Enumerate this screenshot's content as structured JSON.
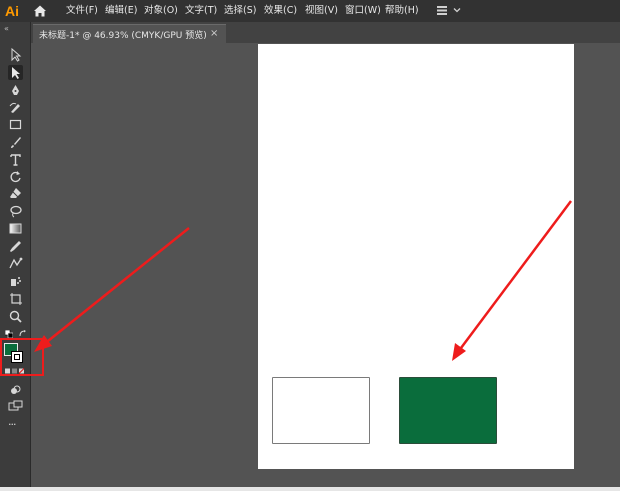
{
  "app": {
    "logo": "Ai"
  },
  "menu": [
    {
      "label": "文件(F)"
    },
    {
      "label": "编辑(E)"
    },
    {
      "label": "对象(O)"
    },
    {
      "label": "文字(T)"
    },
    {
      "label": "选择(S)"
    },
    {
      "label": "效果(C)"
    },
    {
      "label": "视图(V)"
    },
    {
      "label": "窗口(W)"
    },
    {
      "label": "帮助(H)"
    }
  ],
  "document_tab": {
    "title": "未标题-1* @ 46.93% (CMYK/GPU 预览)",
    "close": "×"
  },
  "toolbar": {
    "collapse": "«",
    "tools": [
      {
        "name": "selection-tool"
      },
      {
        "name": "direct-selection-tool"
      },
      {
        "name": "pen-tool"
      },
      {
        "name": "curvature-tool"
      },
      {
        "name": "rectangle-tool"
      },
      {
        "name": "paintbrush-tool"
      },
      {
        "name": "type-tool"
      },
      {
        "name": "rotate-tool"
      },
      {
        "name": "eraser-tool"
      },
      {
        "name": "lasso-tool"
      },
      {
        "name": "gradient-tool"
      },
      {
        "name": "eyedropper-tool"
      },
      {
        "name": "blend-tool"
      },
      {
        "name": "symbol-sprayer-tool"
      },
      {
        "name": "artboard-tool"
      },
      {
        "name": "zoom-tool"
      }
    ],
    "more": "···"
  },
  "colors": {
    "fill": "#0a6d3c",
    "stroke": "#ffffff",
    "accent": "#ff9a00",
    "annotation": "#ee1c1c"
  },
  "artboard": {
    "shapes": [
      {
        "name": "white-rectangle",
        "fill": "#ffffff"
      },
      {
        "name": "green-rectangle",
        "fill": "#0a6d3c"
      }
    ]
  }
}
